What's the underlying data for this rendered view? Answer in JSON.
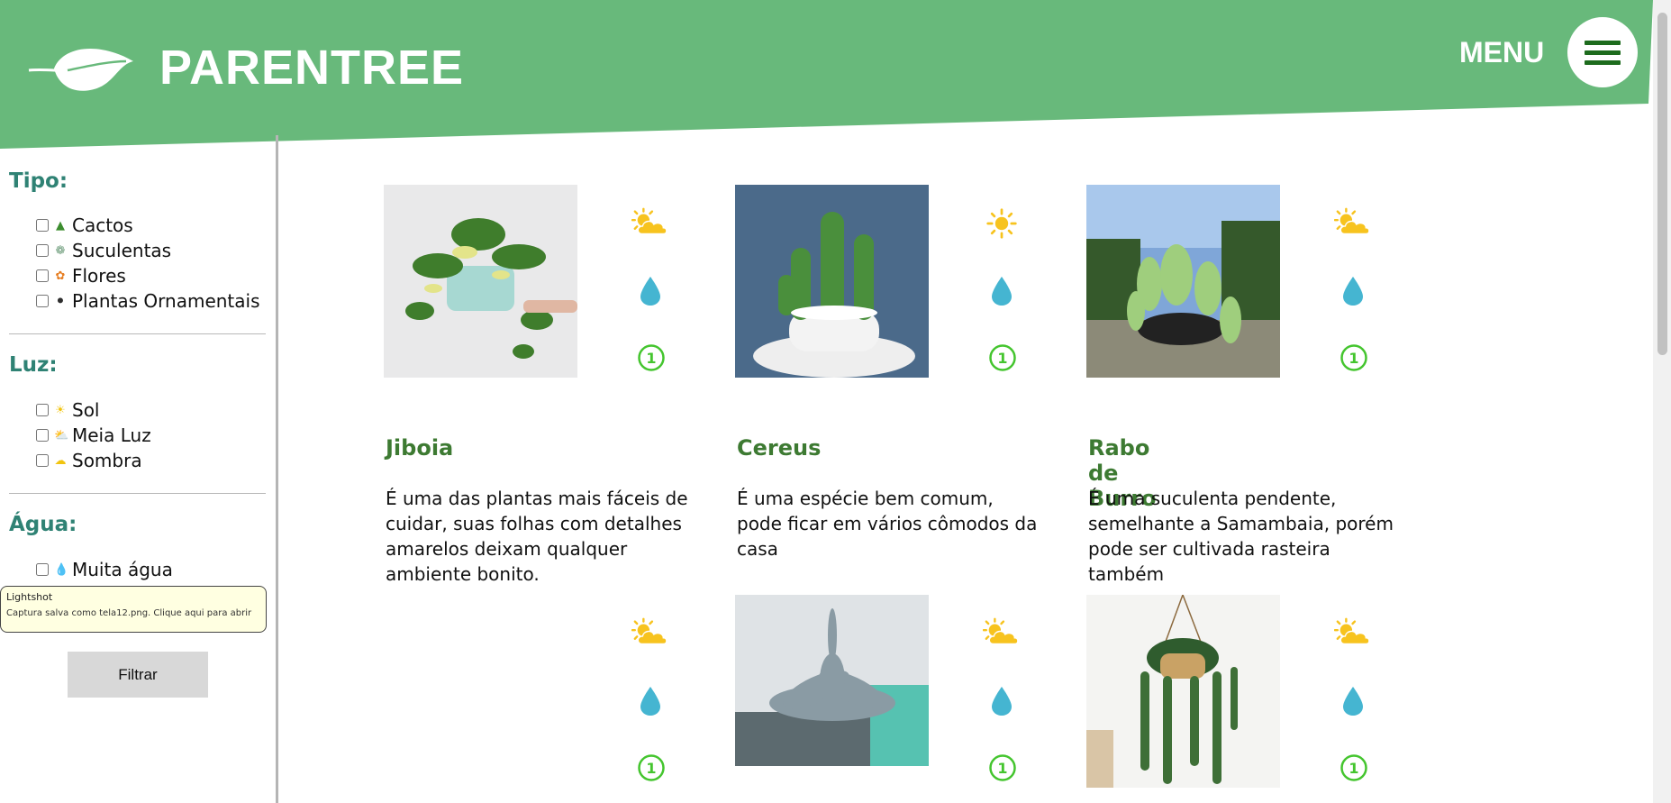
{
  "header": {
    "brand": "PARENTREE",
    "menu_label": "MENU",
    "colors": {
      "banner": "#68b97b",
      "menu_icon": "#1d6b1d"
    }
  },
  "sidebar": {
    "tipo": {
      "title": "Tipo:",
      "items": [
        {
          "label": "Cactos",
          "icon": "cactus-icon"
        },
        {
          "label": "Suculentas",
          "icon": "succulent-icon"
        },
        {
          "label": "Flores",
          "icon": "flower-icon"
        },
        {
          "label": "Plantas Ornamentais",
          "icon": "potted-plant-icon"
        }
      ]
    },
    "luz": {
      "title": "Luz:",
      "items": [
        {
          "label": "Sol",
          "icon": "sun-icon"
        },
        {
          "label": "Meia Luz",
          "icon": "sun-cloud-icon"
        },
        {
          "label": "Sombra",
          "icon": "cloud-icon"
        }
      ]
    },
    "agua": {
      "title": "Água:",
      "items": [
        {
          "label": "Muita água",
          "icon": "water-drops-icon"
        }
      ]
    },
    "filter_button": "Filtrar"
  },
  "tooltip": {
    "title": "Lightshot",
    "text": "Captura salva como tela12.png. Clique aqui para abrir"
  },
  "plants": [
    {
      "name": "Jiboia",
      "description": "É uma das plantas mais fáceis de cuidar, suas folhas com detalhes amarelos deixam qualquer ambiente bonito.",
      "light": "sun-cloud-icon",
      "water": "water-drop-icon",
      "level": "1"
    },
    {
      "name": "Cereus",
      "description": "É uma espécie bem comum, pode ficar em vários cômodos da casa",
      "light": "sun-icon",
      "water": "water-drop-icon",
      "level": "1"
    },
    {
      "name": "Rabo de Burro",
      "description": "É uma suculenta pendente, semelhante a Samambaia, porém pode ser cultivada rasteira também",
      "light": "sun-cloud-icon",
      "water": "water-drop-icon",
      "level": "1"
    },
    {
      "name": "",
      "description": "",
      "light": "sun-cloud-icon",
      "water": "water-drop-icon",
      "level": "1"
    },
    {
      "name": "",
      "description": "",
      "light": "sun-cloud-icon",
      "water": "water-drop-icon",
      "level": "1"
    },
    {
      "name": "",
      "description": "",
      "light": "sun-cloud-icon",
      "water": "water-drop-icon",
      "level": "1"
    }
  ]
}
